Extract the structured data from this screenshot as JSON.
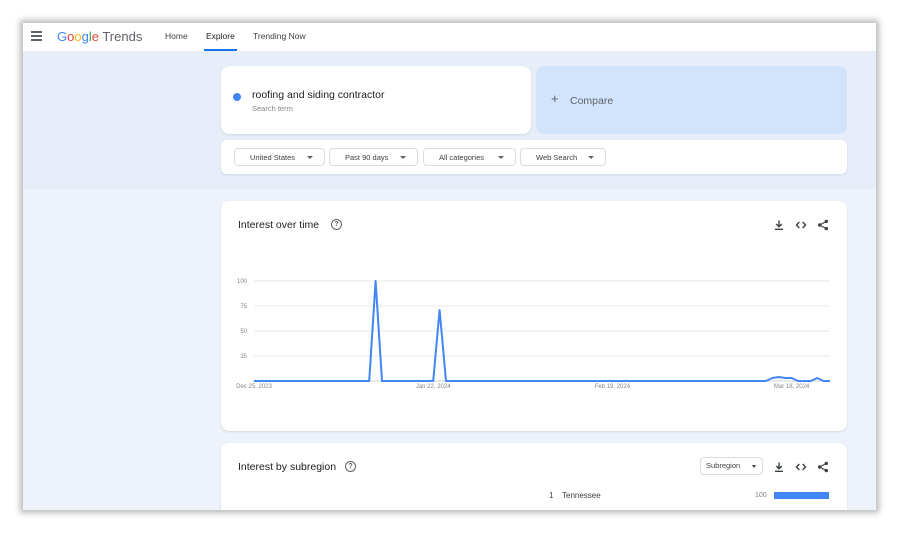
{
  "header": {
    "logo_letters": [
      "G",
      "o",
      "o",
      "g",
      "l",
      "e"
    ],
    "logo_trends": "Trends",
    "nav": [
      {
        "label": "Home",
        "active": false
      },
      {
        "label": "Explore",
        "active": true
      },
      {
        "label": "Trending Now",
        "active": false
      }
    ]
  },
  "search": {
    "term": "roofing and siding contractor",
    "term_type": "Search term",
    "term_color": "#4285f4",
    "compare_label": "Compare"
  },
  "filters": [
    "United States",
    "Past 90 days",
    "All categories",
    "Web Search"
  ],
  "interest_over_time": {
    "title": "Interest over time",
    "icons": [
      "help-icon",
      "download-icon",
      "embed-icon",
      "share-icon"
    ],
    "chart_data": {
      "type": "line",
      "y_ticks": [
        100,
        75,
        50,
        25
      ],
      "ylim": [
        0,
        100
      ],
      "x_tick_labels": [
        "Dec 25, 2023",
        "Jan 22, 2024",
        "Feb 19, 2024",
        "Mar 18, 2024"
      ],
      "x_tick_dates": [
        "2023-12-25",
        "2024-01-22",
        "2024-02-19",
        "2024-03-18"
      ],
      "xlim": [
        "2023-12-25",
        "2024-03-24"
      ],
      "grid": true,
      "line_color": "#4285f4",
      "series": [
        {
          "x": [
            "2023-12-25",
            "2024-01-12",
            "2024-01-13",
            "2024-01-14",
            "2024-01-22",
            "2024-01-23",
            "2024-01-24",
            "2024-03-14",
            "2024-03-15",
            "2024-03-16",
            "2024-03-17",
            "2024-03-18",
            "2024-03-19",
            "2024-03-21",
            "2024-03-22",
            "2024-03-23",
            "2024-03-24"
          ],
          "y": [
            0,
            0,
            100,
            0,
            0,
            71,
            0,
            0,
            3,
            4,
            3,
            3,
            0,
            0,
            3,
            0,
            0
          ]
        }
      ]
    }
  },
  "interest_by_subregion": {
    "title": "Interest by subregion",
    "select_label": "Subregion",
    "rows": [
      {
        "rank": "1",
        "name": "Tennessee",
        "value": "100",
        "fraction": 1.0
      }
    ]
  }
}
